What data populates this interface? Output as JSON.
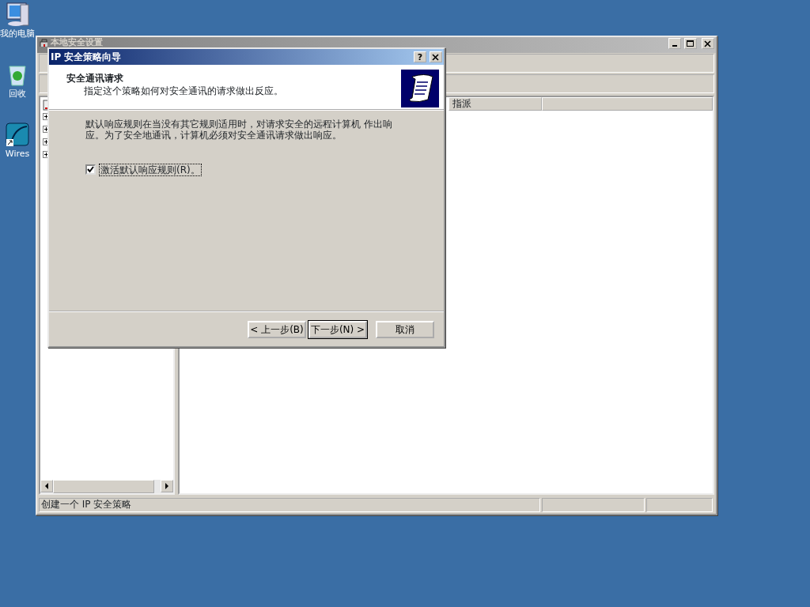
{
  "desktop_icons": [
    {
      "kind": "computer",
      "label": "我的电脑"
    },
    {
      "kind": "recycle",
      "label": "回收"
    },
    {
      "kind": "shark",
      "label": "Wires"
    }
  ],
  "main_window": {
    "title": "本地安全设置",
    "active": false,
    "tree_nodes": [
      {
        "expanded": false
      },
      {
        "expanded": false
      },
      {
        "expanded": false
      },
      {
        "expanded": false
      }
    ],
    "columns": [
      "指派"
    ],
    "status_bar": [
      "创建一个 IP 安全策略"
    ]
  },
  "dialog": {
    "title": "IP 安全策略向导",
    "help_button": "?",
    "header": {
      "title": "安全通讯请求",
      "subtitle": "指定这个策略如何对安全通讯的请求做出反应。"
    },
    "body_lines": [
      "默认响应规则在当没有其它规则适用时，对请求安全的远程计算机 作出响",
      "应。为了安全地通讯，计算机必须对安全通讯请求做出响应。"
    ],
    "checkbox": {
      "label": "激活默认响应规则(R)。",
      "checked": true
    },
    "buttons": [
      {
        "label": "< 上一步(B)",
        "default": false
      },
      {
        "label": "下一步(N) >",
        "default": true
      },
      {
        "label": "取消",
        "default": false
      }
    ]
  }
}
